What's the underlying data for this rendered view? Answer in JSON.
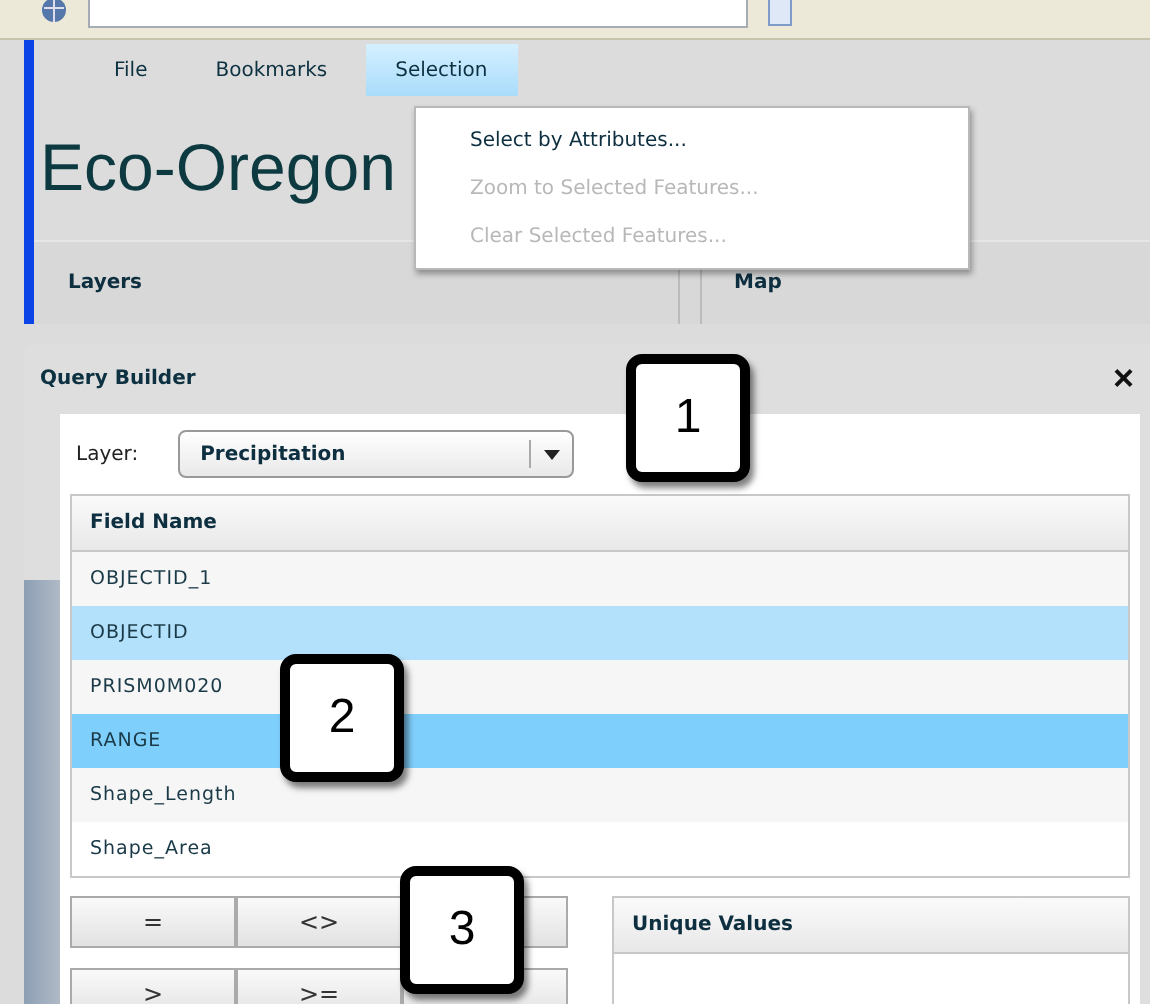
{
  "menu_bar": [
    {
      "label": "File",
      "open": false
    },
    {
      "label": "Bookmarks",
      "open": false
    },
    {
      "label": "Selection",
      "open": true
    }
  ],
  "dropdown": [
    {
      "label": "Select by Attributes...",
      "disabled": false
    },
    {
      "label": "Zoom to Selected Features...",
      "disabled": true
    },
    {
      "label": "Clear Selected Features...",
      "disabled": true
    }
  ],
  "app_title": "Eco-Oregon",
  "panels": {
    "left": "Layers",
    "right": "Map"
  },
  "query_builder": {
    "title": "Query Builder",
    "close": "×",
    "layer_label": "Layer:",
    "layer_value": "Precipitation",
    "table_header": "Field Name",
    "fields": [
      {
        "name": "OBJECTID_1",
        "selected": false,
        "hovered": false
      },
      {
        "name": "OBJECTID",
        "selected": false,
        "hovered": true
      },
      {
        "name": "PRISM0M020",
        "selected": false,
        "hovered": false
      },
      {
        "name": "RANGE",
        "selected": true,
        "hovered": false
      },
      {
        "name": "Shape_Length",
        "selected": false,
        "hovered": false
      },
      {
        "name": "Shape_Area",
        "selected": false,
        "hovered": false
      }
    ],
    "operators": [
      [
        "=",
        "<>"
      ],
      [
        ">",
        ">="
      ]
    ],
    "unique_values_title": "Unique Values"
  },
  "callouts": [
    "1",
    "2",
    "3"
  ]
}
